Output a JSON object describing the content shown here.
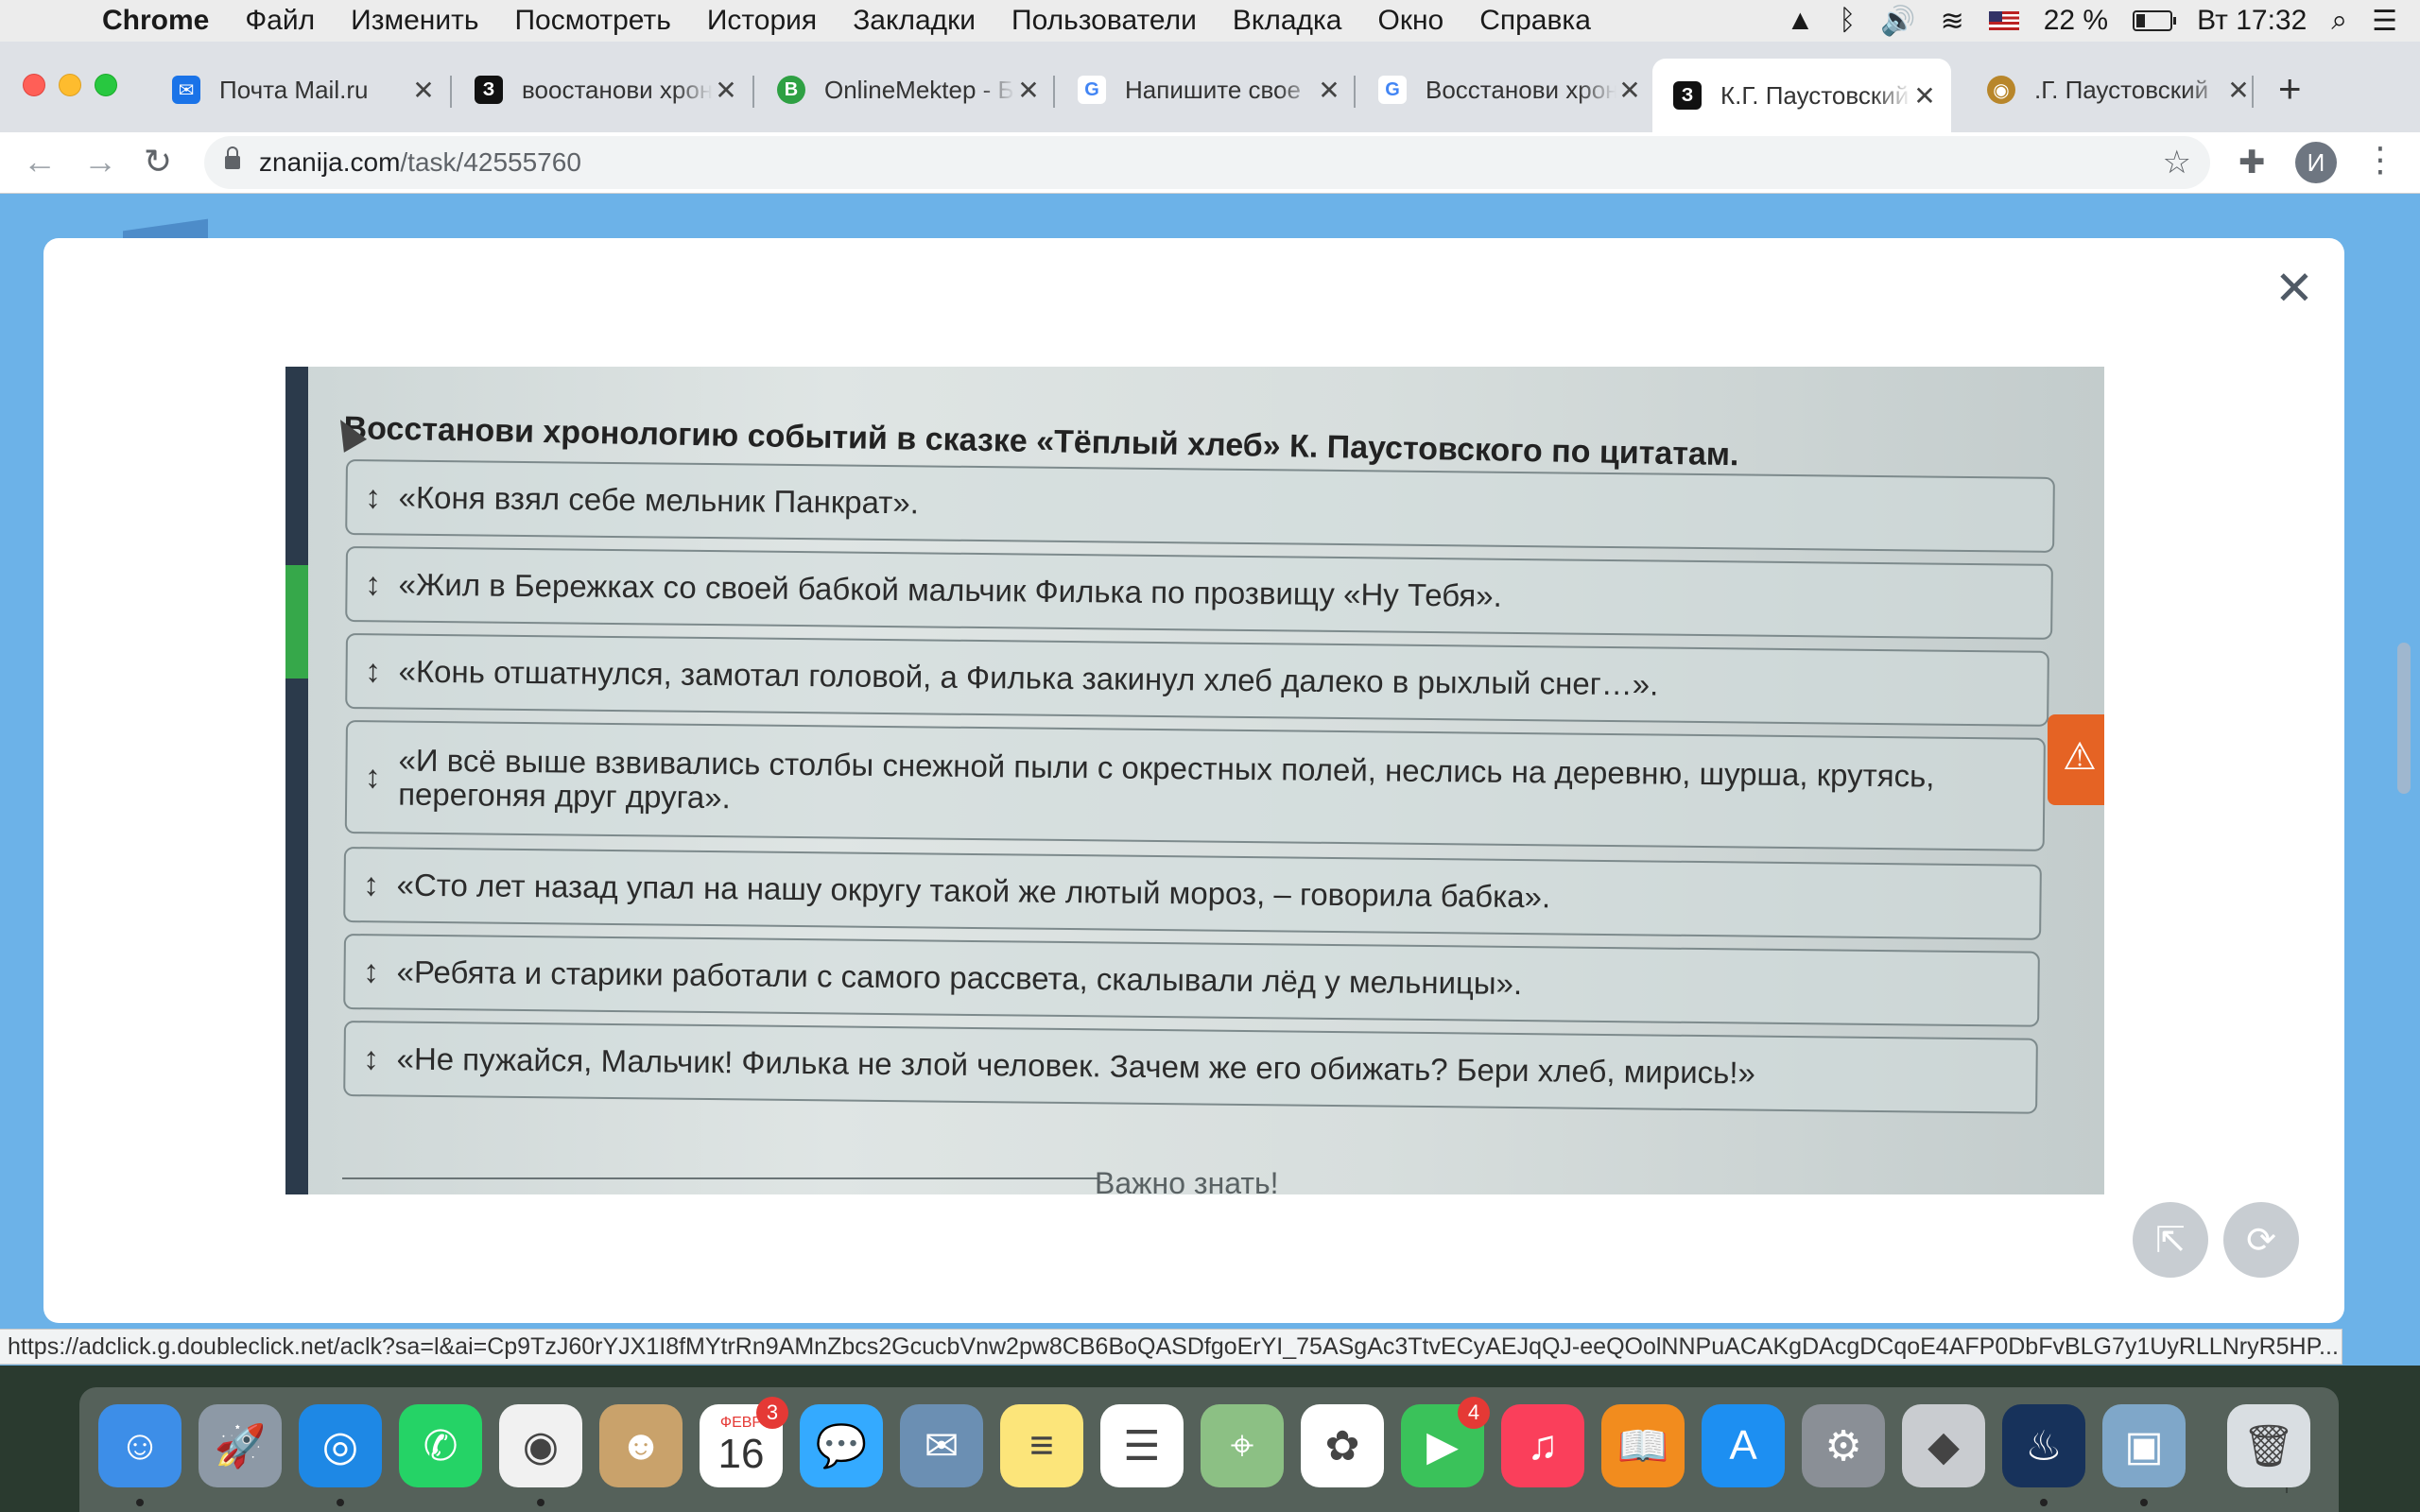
{
  "menubar": {
    "app_name": "Chrome",
    "items": [
      "Файл",
      "Изменить",
      "Посмотреть",
      "История",
      "Закладки",
      "Пользователи",
      "Вкладка",
      "Окно",
      "Справка"
    ],
    "battery_percent": "22 %",
    "clock": "Вт 17:32"
  },
  "tabs": [
    {
      "title": "Почта Mail.ru",
      "favicon": "mail-icon",
      "color": "#1a73e8"
    },
    {
      "title": "воостанови хрон",
      "favicon": "znanija-icon",
      "color": "#111111"
    },
    {
      "title": "OnlineMektep - Б",
      "favicon": "onlinemektep-icon",
      "color": "#2ea043"
    },
    {
      "title": "Напишите свое",
      "favicon": "google-icon",
      "color": "#4285f4"
    },
    {
      "title": "Восстанови хрон",
      "favicon": "google-icon",
      "color": "#4285f4"
    },
    {
      "title": "К.Г. Паустовский",
      "favicon": "znanija-icon",
      "color": "#111111",
      "active": true
    },
    {
      "title": ".Г. Паустовский",
      "favicon": "podcast-icon",
      "color": "#b8862b"
    }
  ],
  "toolbar": {
    "url_host": "znanija.com",
    "url_path": "/task/42555760",
    "avatar_letter": "И"
  },
  "task": {
    "title": "Восстанови хронологию событий в сказке «Тёплый хлеб» К. Паустовского по цитатам.",
    "items": [
      "«Коня взял себе мельник Панкрат».",
      "«Жил в Бережках со своей бабкой мальчик Филька по прозвищу «Ну Тебя».",
      "«Конь отшатнулся, замотал головой, а Филька закинул хлеб далеко в рыхлый снег…».",
      "«И всё выше взвивались столбы снежной пыли с окрестных полей, неслись на деревню, шурша, крутясь, перегоняя друг друга».",
      "«Сто лет назад упал на нашу округу такой же лютый мороз, – говорила бабка».",
      "«Ребята и старики работали с самого рассвета, скалывали лёд у мельницы».",
      "«Не пужайся, Мальчик! Филька не злой человек. Зачем же его обижать? Бери хлеб, мирись!»"
    ],
    "footer_label": "Важно знать!"
  },
  "status_url": "https://adclick.g.doubleclick.net/aclk?sa=l&ai=Cp9TzJ60rYJX1I8fMYtrRn9AMnZbcs2GcucbVnw2pw8CB6BoQASDfgoErYI_75ASgAc3TtvECyAEJqQJ-eeQOolNNPuACAKgDAcgDCqoE4AFP0DbFvBLG7y1UyRLLNryR5HP...",
  "dock": [
    {
      "name": "finder-icon",
      "bg": "#3d8ee8",
      "glyph": "☺",
      "running": true
    },
    {
      "name": "launchpad-icon",
      "bg": "#8d99a6",
      "glyph": "🚀"
    },
    {
      "name": "safari-icon",
      "bg": "#1e88e5",
      "glyph": "◎",
      "running": true
    },
    {
      "name": "whatsapp-icon",
      "bg": "#25d366",
      "glyph": "✆"
    },
    {
      "name": "chrome-icon",
      "bg": "#f1f1f1",
      "glyph": "◉",
      "running": true
    },
    {
      "name": "contacts-icon",
      "bg": "#c9a26b",
      "glyph": "☻"
    },
    {
      "name": "calendar-icon",
      "bg": "#ffffff",
      "glyph": "16",
      "badge": "3",
      "month": "ФЕВР"
    },
    {
      "name": "messages-icon",
      "bg": "#34aaff",
      "glyph": "💬"
    },
    {
      "name": "mail-stamp-icon",
      "bg": "#6b8fb3",
      "glyph": "✉"
    },
    {
      "name": "notes-icon",
      "bg": "#fce57a",
      "glyph": "≡"
    },
    {
      "name": "reminders-icon",
      "bg": "#ffffff",
      "glyph": "☰"
    },
    {
      "name": "maps-icon",
      "bg": "#8cc084",
      "glyph": "⌖"
    },
    {
      "name": "photos-icon",
      "bg": "#ffffff",
      "glyph": "✿"
    },
    {
      "name": "facetime-icon",
      "bg": "#3ac25a",
      "glyph": "▶",
      "badge": "4"
    },
    {
      "name": "music-icon",
      "bg": "#fa3f5b",
      "glyph": "♫"
    },
    {
      "name": "books-icon",
      "bg": "#f28c1e",
      "glyph": "📖"
    },
    {
      "name": "appstore-icon",
      "bg": "#1d8ff2",
      "glyph": "A"
    },
    {
      "name": "system-preferences-icon",
      "bg": "#8a8f96",
      "glyph": "⚙"
    },
    {
      "name": "roblox-icon",
      "bg": "#c9ccd0",
      "glyph": "◆"
    },
    {
      "name": "steam-icon",
      "bg": "#17325b",
      "glyph": "♨",
      "running": true
    },
    {
      "name": "preview-icon",
      "bg": "#7fa7c9",
      "glyph": "▣",
      "running": true
    },
    {
      "name": "trash-icon",
      "bg": "#d9dee2",
      "glyph": "🗑"
    }
  ]
}
